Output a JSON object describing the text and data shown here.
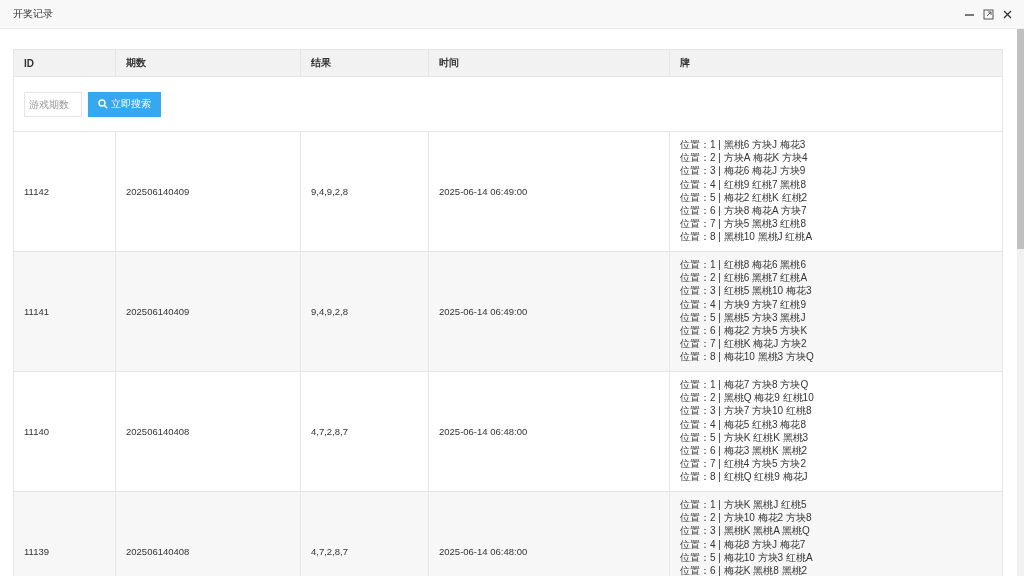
{
  "window": {
    "title": "开奖记录"
  },
  "table": {
    "columns": [
      "ID",
      "期数",
      "结果",
      "时间",
      "牌"
    ],
    "search": {
      "placeholder": "游戏期数",
      "button": "立即搜索"
    },
    "rows": [
      {
        "id": "11142",
        "period": "202506140409",
        "result": "9,4,9,2,8",
        "time": "2025-06-14 06:49:00",
        "cards": [
          "位置：1 | 黑桃6 方块J 梅花3",
          "位置：2 | 方块A 梅花K 方块4",
          "位置：3 | 梅花6 梅花J 方块9",
          "位置：4 | 红桃9 红桃7 黑桃8",
          "位置：5 | 梅花2 红桃K 红桃2",
          "位置：6 | 方块8 梅花A 方块7",
          "位置：7 | 方块5 黑桃3 红桃8",
          "位置：8 | 黑桃10 黑桃J 红桃A"
        ]
      },
      {
        "id": "11141",
        "period": "202506140409",
        "result": "9,4,9,2,8",
        "time": "2025-06-14 06:49:00",
        "cards": [
          "位置：1 | 红桃8 梅花6 黑桃6",
          "位置：2 | 红桃6 黑桃7 红桃A",
          "位置：3 | 红桃5 黑桃10 梅花3",
          "位置：4 | 方块9 方块7 红桃9",
          "位置：5 | 黑桃5 方块3 黑桃J",
          "位置：6 | 梅花2 方块5 方块K",
          "位置：7 | 红桃K 梅花J 方块2",
          "位置：8 | 梅花10 黑桃3 方块Q"
        ]
      },
      {
        "id": "11140",
        "period": "202506140408",
        "result": "4,7,2,8,7",
        "time": "2025-06-14 06:48:00",
        "cards": [
          "位置：1 | 梅花7 方块8 方块Q",
          "位置：2 | 黑桃Q 梅花9 红桃10",
          "位置：3 | 方块7 方块10 红桃8",
          "位置：4 | 梅花5 红桃3 梅花8",
          "位置：5 | 方块K 红桃K 黑桃3",
          "位置：6 | 梅花3 黑桃K 黑桃2",
          "位置：7 | 红桃4 方块5 方块2",
          "位置：8 | 红桃Q 红桃9 梅花J"
        ]
      },
      {
        "id": "11139",
        "period": "202506140408",
        "result": "4,7,2,8,7",
        "time": "2025-06-14 06:48:00",
        "cards": [
          "位置：1 | 方块K 黑桃J 红桃5",
          "位置：2 | 方块10 梅花2 方块8",
          "位置：3 | 黑桃K 黑桃A 黑桃Q",
          "位置：4 | 梅花8 方块J 梅花7",
          "位置：5 | 梅花10 方块3 红桃A",
          "位置：6 | 梅花K 黑桃8 黑桃2"
        ]
      }
    ]
  }
}
